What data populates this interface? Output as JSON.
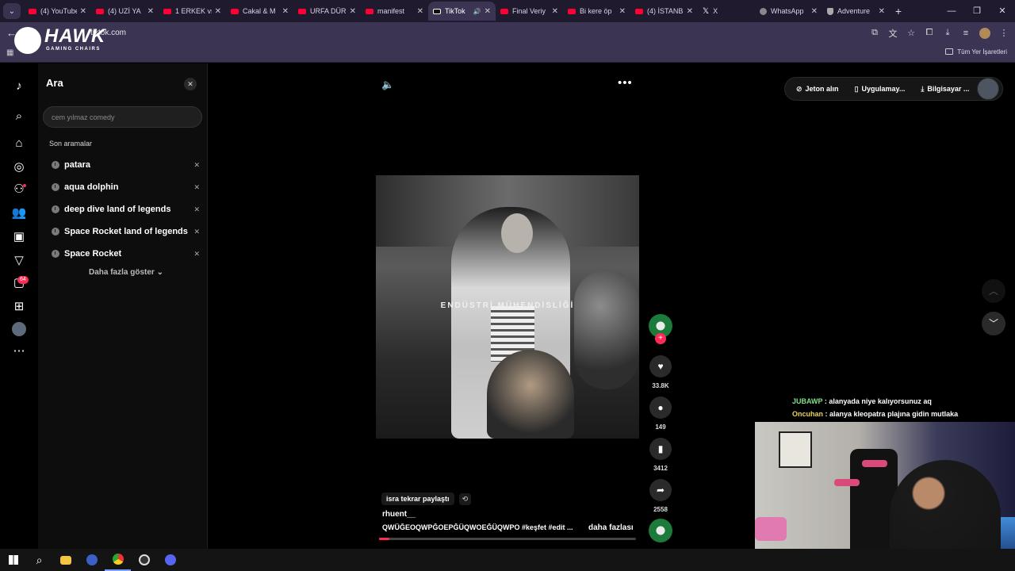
{
  "browser": {
    "tabs": [
      {
        "title": "(4) YouTube",
        "favicon": "youtube-icon",
        "active": false
      },
      {
        "title": "(4) UZİ YA",
        "favicon": "youtube-icon",
        "active": false
      },
      {
        "title": "1 ERKEK vs",
        "favicon": "youtube-icon",
        "active": false
      },
      {
        "title": "Cakal & M",
        "favicon": "youtube-icon",
        "active": false
      },
      {
        "title": "URFA DÜR",
        "favicon": "youtube-icon",
        "active": false
      },
      {
        "title": "manifest",
        "favicon": "youtube-icon",
        "active": false
      },
      {
        "title": "TikTok",
        "favicon": "tiktok-icon",
        "active": true
      },
      {
        "title": "Final Veriy",
        "favicon": "youtube-icon",
        "active": false
      },
      {
        "title": "Bi kere öp",
        "favicon": "youtube-icon",
        "active": false
      },
      {
        "title": "(4) İSTANB",
        "favicon": "youtube-icon",
        "active": false
      },
      {
        "title": "X",
        "favicon": "x-icon",
        "active": false
      },
      {
        "title": "WhatsApp",
        "favicon": "globe-icon",
        "active": false
      },
      {
        "title": "Adventure",
        "favicon": "shield-icon",
        "active": false
      }
    ],
    "url": "tiktok.com",
    "bookmarks_all": "Tüm Yer İşaretleri"
  },
  "overlay_logo": {
    "brand": "HAWK",
    "subtitle": "GAMING CHAIRS"
  },
  "search_panel": {
    "title": "Ara",
    "input_value": "",
    "input_placeholder": "cem yılmaz comedy",
    "recent_label": "Son aramalar",
    "recent": [
      "patara",
      "aqua dolphin",
      "deep dive land of legends",
      "Space Rocket land of legends",
      "Space Rocket"
    ],
    "show_more": "Daha fazla göster"
  },
  "rail": {
    "notification_count": "64"
  },
  "topbar": {
    "coins": "Jeton alın",
    "app": "Uygulamay...",
    "desktop": "Bilgisayar ..."
  },
  "video": {
    "caption_overlay": "ENDÜSTRİ MÜHENDİSLİĞİ",
    "likes": "33.8K",
    "comments": "149",
    "saves": "3412",
    "shares": "2558",
    "repost_tag": "isra tekrar paylaştı",
    "author": "rhuent__",
    "description": "QWÜĞEOQWPĞOEPĞÜQWOEĞÜQWPO #keşfet #edit ...",
    "more": "daha fazlası",
    "progress": 0.04
  },
  "stream_chat": [
    {
      "user": "JUBAWP",
      "message": ": alanyada niye kalıyorsunuz aq"
    },
    {
      "user": "Oncuhan",
      "message": ": alanya kleopatra plajına gidin mutlaka"
    }
  ],
  "colors": {
    "accent": "#fe2c55",
    "chrome": "#3b3452",
    "tabstrip": "#1f1a2e"
  }
}
